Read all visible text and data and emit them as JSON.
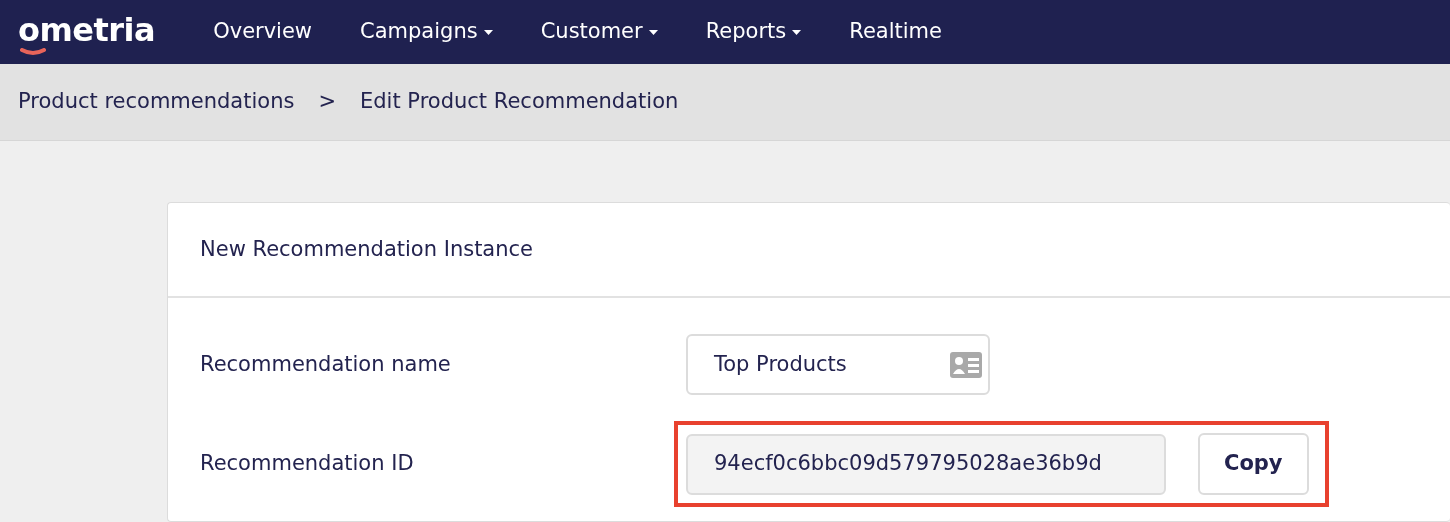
{
  "logo": "ometria",
  "nav": [
    {
      "label": "Overview",
      "dropdown": false
    },
    {
      "label": "Campaigns",
      "dropdown": true
    },
    {
      "label": "Customer",
      "dropdown": true
    },
    {
      "label": "Reports",
      "dropdown": true
    },
    {
      "label": "Realtime",
      "dropdown": false
    }
  ],
  "breadcrumb": {
    "items": [
      "Product recommendations",
      "Edit Product Recommendation"
    ],
    "separator": ">"
  },
  "card": {
    "title": "New Recommendation Instance",
    "fields": [
      {
        "kind": "text",
        "label": "Recommendation name",
        "value": "Top Products",
        "highlighted": false
      },
      {
        "kind": "copy",
        "label": "Recommendation ID",
        "value": "94ecf0c6bbc09d579795028ae36b9d",
        "button": "Copy",
        "highlighted": true
      }
    ]
  }
}
